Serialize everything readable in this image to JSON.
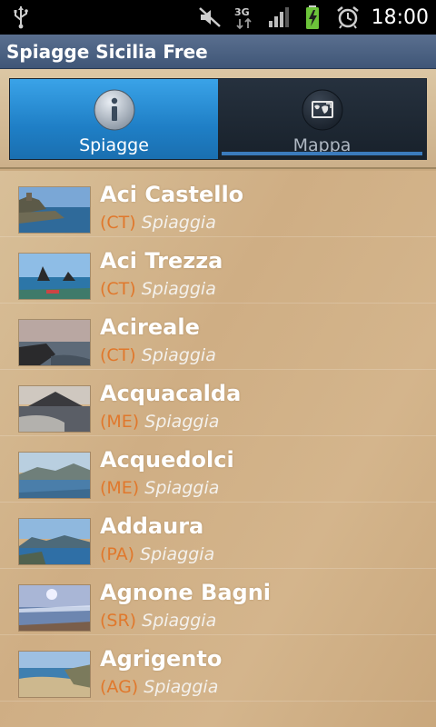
{
  "status_bar": {
    "time": "18:00",
    "network": "3G",
    "icons": [
      "usb-icon",
      "mute-icon",
      "3g-icon",
      "signal-icon",
      "battery-charging-icon",
      "alarm-icon"
    ]
  },
  "app": {
    "title": "Spiagge Sicilia Free"
  },
  "tabs": [
    {
      "label": "Spiagge",
      "icon": "info-icon",
      "active": true
    },
    {
      "label": "Mappa",
      "icon": "map-icon",
      "active": false
    }
  ],
  "beaches": [
    {
      "name": "Aci Castello",
      "province": "(CT)",
      "type": "Spiaggia"
    },
    {
      "name": "Aci Trezza",
      "province": "(CT)",
      "type": "Spiaggia"
    },
    {
      "name": "Acireale",
      "province": "(CT)",
      "type": "Spiaggia"
    },
    {
      "name": "Acquacalda",
      "province": "(ME)",
      "type": "Spiaggia"
    },
    {
      "name": "Acquedolci",
      "province": "(ME)",
      "type": "Spiaggia"
    },
    {
      "name": "Addaura",
      "province": "(PA)",
      "type": "Spiaggia"
    },
    {
      "name": "Agnone Bagni",
      "province": "(SR)",
      "type": "Spiaggia"
    },
    {
      "name": "Agrigento",
      "province": "(AG)",
      "type": "Spiaggia"
    }
  ],
  "colors": {
    "accent_tab": "#1f7fc6",
    "province_text": "#e0782c",
    "title_bar": "#4a6080"
  }
}
